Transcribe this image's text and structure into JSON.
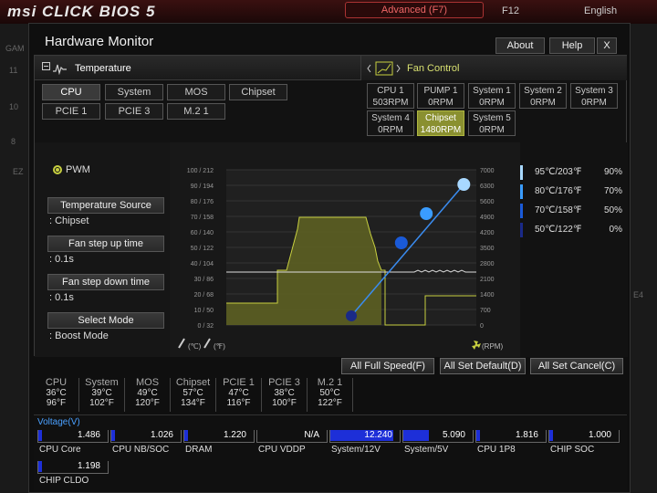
{
  "app": {
    "logo": "msi CLICK BIOS 5",
    "mode_button": "Advanced (F7)",
    "f12": "F12",
    "language": "English",
    "bg_numbers": [
      "11",
      "10",
      "8"
    ],
    "bg_text": [
      "GAM",
      "EZ",
      "E4"
    ]
  },
  "window": {
    "title": "Hardware Monitor",
    "about": "About",
    "help": "Help",
    "close": "X"
  },
  "temperature": {
    "header": "Temperature",
    "tabs": [
      "CPU",
      "System",
      "MOS",
      "Chipset",
      "PCIE 1",
      "PCIE 3",
      "M.2 1"
    ],
    "selected": "CPU"
  },
  "fan_control": {
    "header": "Fan Control",
    "fans": [
      {
        "name": "CPU 1",
        "rpm": "503RPM"
      },
      {
        "name": "PUMP 1",
        "rpm": "0RPM"
      },
      {
        "name": "System 1",
        "rpm": "0RPM"
      },
      {
        "name": "System 2",
        "rpm": "0RPM"
      },
      {
        "name": "System 3",
        "rpm": "0RPM"
      },
      {
        "name": "System 4",
        "rpm": "0RPM"
      },
      {
        "name": "Chipset",
        "rpm": "1480RPM"
      },
      {
        "name": "System 5",
        "rpm": "0RPM"
      }
    ],
    "selected": "Chipset"
  },
  "controls": {
    "mode_label": "PWM",
    "temp_source_btn": "Temperature Source",
    "temp_source_val": ": Chipset",
    "step_up_btn": "Fan step up time",
    "step_up_val": ": 0.1s",
    "step_down_btn": "Fan step down time",
    "step_down_val": ": 0.1s",
    "select_mode_btn": "Select Mode",
    "select_mode_val": ": Boost Mode"
  },
  "graph": {
    "temp_ticks": [
      "100 / 212",
      "90 / 194",
      "80 / 176",
      "70 / 158",
      "60 / 140",
      "50 / 122",
      "40 / 104",
      "30 /  86",
      "20 /  68",
      "10 /  50",
      "0 /  32"
    ],
    "rpm_ticks": [
      "7000",
      "6300",
      "5600",
      "4900",
      "4200",
      "3500",
      "2800",
      "2100",
      "1400",
      "700",
      "0"
    ],
    "celsius_label": "(℃)",
    "fahrenheit_label": "(℉)",
    "rpm_label": "(RPM)",
    "curve_points": [
      {
        "temp_c": 95,
        "percent": 90
      },
      {
        "temp_c": 80,
        "percent": 70
      },
      {
        "temp_c": 70,
        "percent": 50
      },
      {
        "temp_c": 50,
        "percent": 0
      }
    ]
  },
  "legend": [
    {
      "temp": "95℃/203℉",
      "pct": "90%",
      "color": "#a8d8ff"
    },
    {
      "temp": "80℃/176℉",
      "pct": "70%",
      "color": "#3a9cff"
    },
    {
      "temp": "70℃/158℉",
      "pct": "50%",
      "color": "#1a5ad8"
    },
    {
      "temp": "50℃/122℉",
      "pct": "0%",
      "color": "#1a2a88"
    }
  ],
  "actions": {
    "full_speed": "All Full Speed(F)",
    "set_default": "All Set Default(D)",
    "set_cancel": "All Set Cancel(C)"
  },
  "readings": [
    {
      "name": "CPU",
      "c": "36°C",
      "f": "96°F"
    },
    {
      "name": "System",
      "c": "39°C",
      "f": "102°F"
    },
    {
      "name": "MOS",
      "c": "49°C",
      "f": "120°F"
    },
    {
      "name": "Chipset",
      "c": "57°C",
      "f": "134°F"
    },
    {
      "name": "PCIE 1",
      "c": "47°C",
      "f": "116°F"
    },
    {
      "name": "PCIE 3",
      "c": "38°C",
      "f": "100°F"
    },
    {
      "name": "M.2 1",
      "c": "50°C",
      "f": "122°F"
    }
  ],
  "voltage": {
    "title": "Voltage(V)",
    "items": [
      {
        "label": "CPU Core",
        "value": "1.486",
        "fill": 0.02
      },
      {
        "label": "CPU NB/SOC",
        "value": "1.026",
        "fill": 0.02
      },
      {
        "label": "DRAM",
        "value": "1.220",
        "fill": 0.02
      },
      {
        "label": "CPU VDDP",
        "value": "N/A",
        "fill": 0
      },
      {
        "label": "System/12V",
        "value": "12.240",
        "fill": 0.88
      },
      {
        "label": "System/5V",
        "value": "5.090",
        "fill": 0.36
      },
      {
        "label": "CPU 1P8",
        "value": "1.816",
        "fill": 0.02
      },
      {
        "label": "CHIP SOC",
        "value": "1.000",
        "fill": 0.02
      },
      {
        "label": "CHIP CLDO",
        "value": "1.198",
        "fill": 0.02
      }
    ]
  }
}
